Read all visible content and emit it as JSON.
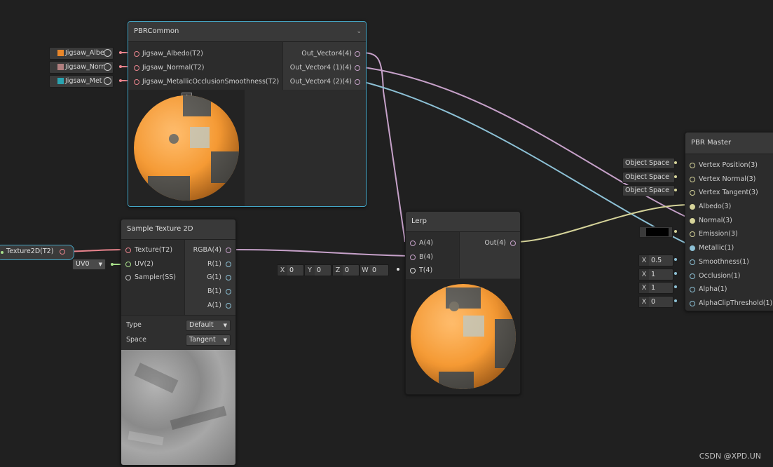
{
  "colors": {
    "wire_vector4": "#c6a1c9",
    "wire_vector3": "#d6d49a",
    "wire_vector1": "#8dc1d6",
    "wire_texture": "#e8838c",
    "wire_uv": "#a8e08a",
    "sphere_orange": "#f59a34",
    "selection": "#44a7c7"
  },
  "property_nodes": [
    {
      "label": "Jigsaw_Albe",
      "swatch": "#e8862a",
      "icon": "target-icon"
    },
    {
      "label": "Jigsaw_Norr",
      "swatch": "#b07f7f",
      "icon": "target-icon"
    },
    {
      "label": "Jigsaw_Met",
      "swatch": "#2aa3b0",
      "icon": "target-icon"
    }
  ],
  "pbr_common": {
    "title": "PBRCommon",
    "inputs": [
      "Jigsaw_Albedo(T2)",
      "Jigsaw_Normal(T2)",
      "Jigsaw_MetallicOcclusionSmoothness(T2)"
    ],
    "outputs": [
      "Out_Vector4(4)",
      "Out_Vector4 (1)(4)",
      "Out_Vector4 (2)(4)"
    ]
  },
  "texture_prop": {
    "label": "Texture2D(T2)"
  },
  "uv_dropdown": {
    "value": "UV0"
  },
  "sample_texture": {
    "title": "Sample Texture 2D",
    "inputs": [
      "Texture(T2)",
      "UV(2)",
      "Sampler(SS)"
    ],
    "outputs": [
      "RGBA(4)",
      "R(1)",
      "G(1)",
      "B(1)",
      "A(1)"
    ],
    "type_label": "Type",
    "type_value": "Default",
    "space_label": "Space",
    "space_value": "Tangent"
  },
  "lerp": {
    "title": "Lerp",
    "inputs": [
      "A(4)",
      "B(4)",
      "T(4)"
    ],
    "outputs": [
      "Out(4)"
    ],
    "t_vector": [
      {
        "axis": "X",
        "value": "0"
      },
      {
        "axis": "Y",
        "value": "0"
      },
      {
        "axis": "Z",
        "value": "0"
      },
      {
        "axis": "W",
        "value": "0"
      }
    ]
  },
  "pbr_master": {
    "title": "PBR Master",
    "inputs": [
      "Vertex Position(3)",
      "Vertex Normal(3)",
      "Vertex Tangent(3)",
      "Albedo(3)",
      "Normal(3)",
      "Emission(3)",
      "Metallic(1)",
      "Smoothness(1)",
      "Occlusion(1)",
      "Alpha(1)",
      "AlphaClipThreshold(1)"
    ],
    "space_fields": [
      "Object Space",
      "Object Space",
      "Object Space"
    ],
    "x_fields": [
      {
        "axis": "X",
        "value": "0.5"
      },
      {
        "axis": "X",
        "value": "1"
      },
      {
        "axis": "X",
        "value": "1"
      },
      {
        "axis": "X",
        "value": "0"
      }
    ]
  },
  "watermark": "CSDN @XPD.UN"
}
